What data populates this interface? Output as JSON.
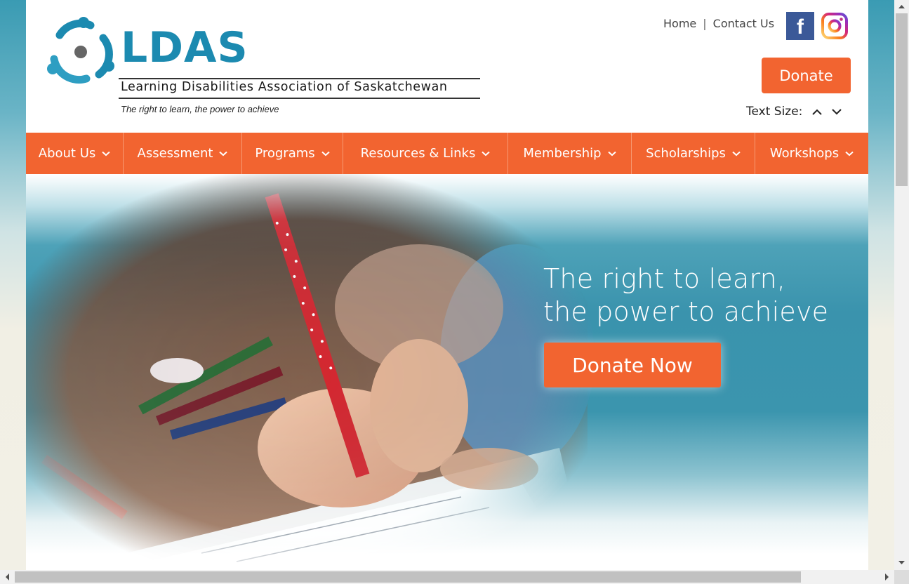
{
  "header": {
    "logo_title": "LDAS",
    "logo_subtitle": "Learning Disabilities Association of Saskatchewan",
    "logo_tagline": "The right to learn, the power to achieve",
    "top_links": [
      "Home",
      "Contact Us"
    ],
    "top_links_separator": "|",
    "social": {
      "facebook": "f",
      "instagram_icon": "instagram-icon"
    },
    "donate_label": "Donate",
    "text_size_label": "Text Size:"
  },
  "nav": {
    "items": [
      {
        "label": "About Us"
      },
      {
        "label": "Assessment"
      },
      {
        "label": "Programs"
      },
      {
        "label": "Resources & Links"
      },
      {
        "label": "Membership"
      },
      {
        "label": "Scholarships"
      },
      {
        "label": "Workshops"
      }
    ]
  },
  "hero": {
    "headline_line1": "The right to learn,",
    "headline_line2": "the power to achieve",
    "cta_label": "Donate Now"
  },
  "colors": {
    "brand_orange": "#f26430",
    "brand_teal": "#1c8ab0",
    "facebook_blue": "#3b5998"
  }
}
